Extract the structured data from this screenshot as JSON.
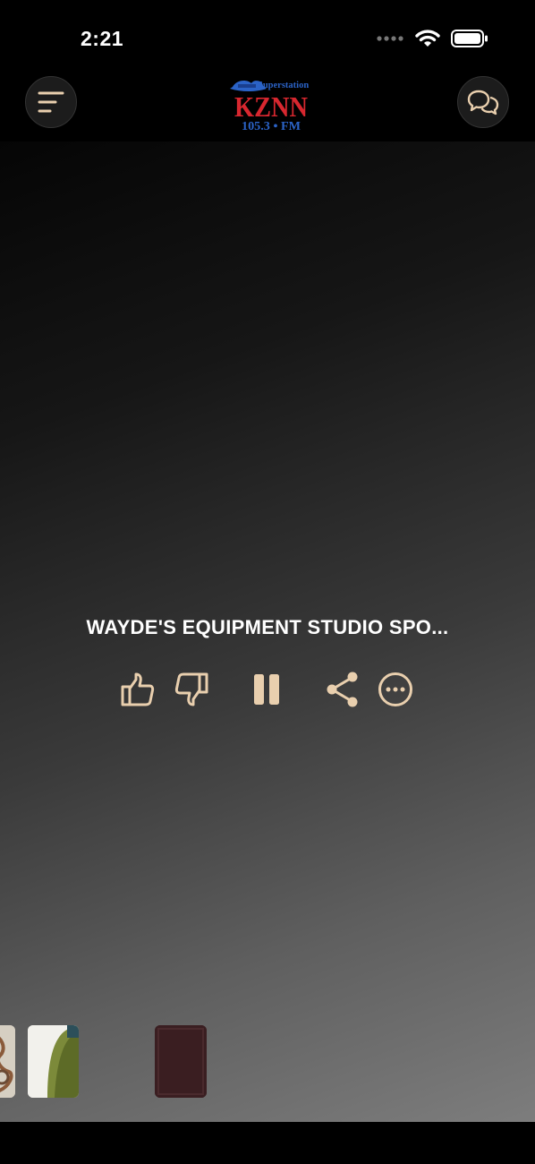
{
  "status_bar": {
    "time": "2:21"
  },
  "header": {
    "logo": {
      "line1": "Superstation",
      "line2": "KZNN",
      "line3": "105.3 • FM"
    },
    "menu_icon": "menu-icon",
    "chat_icon": "chat-icon"
  },
  "player": {
    "track_title": "WAYDE'S EQUIPMENT STUDIO SPO...",
    "controls": [
      "thumbs-up-icon",
      "thumbs-down-icon",
      "pause-icon",
      "share-icon",
      "more-icon"
    ]
  },
  "colors": {
    "accent": "#e9cfae",
    "logo_red": "#d7272f",
    "logo_blue": "#2b63c7"
  }
}
